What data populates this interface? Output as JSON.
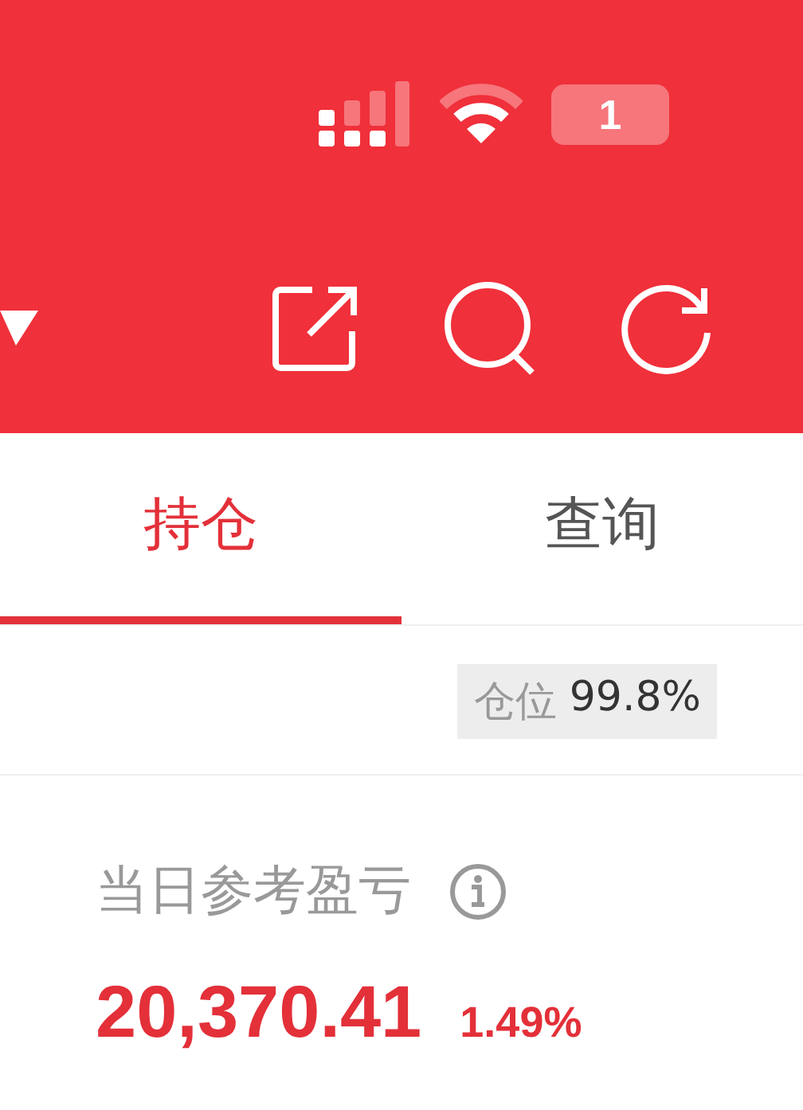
{
  "status_bar": {
    "battery": "1"
  },
  "tabs": [
    {
      "label": "持仓",
      "selected": true
    },
    {
      "label": "查询",
      "selected": false
    }
  ],
  "position": {
    "label": "仓位",
    "value": "99.8%"
  },
  "pnl": {
    "label": "当日参考盈亏",
    "value": "20,370.41",
    "percent": "1.49%"
  }
}
